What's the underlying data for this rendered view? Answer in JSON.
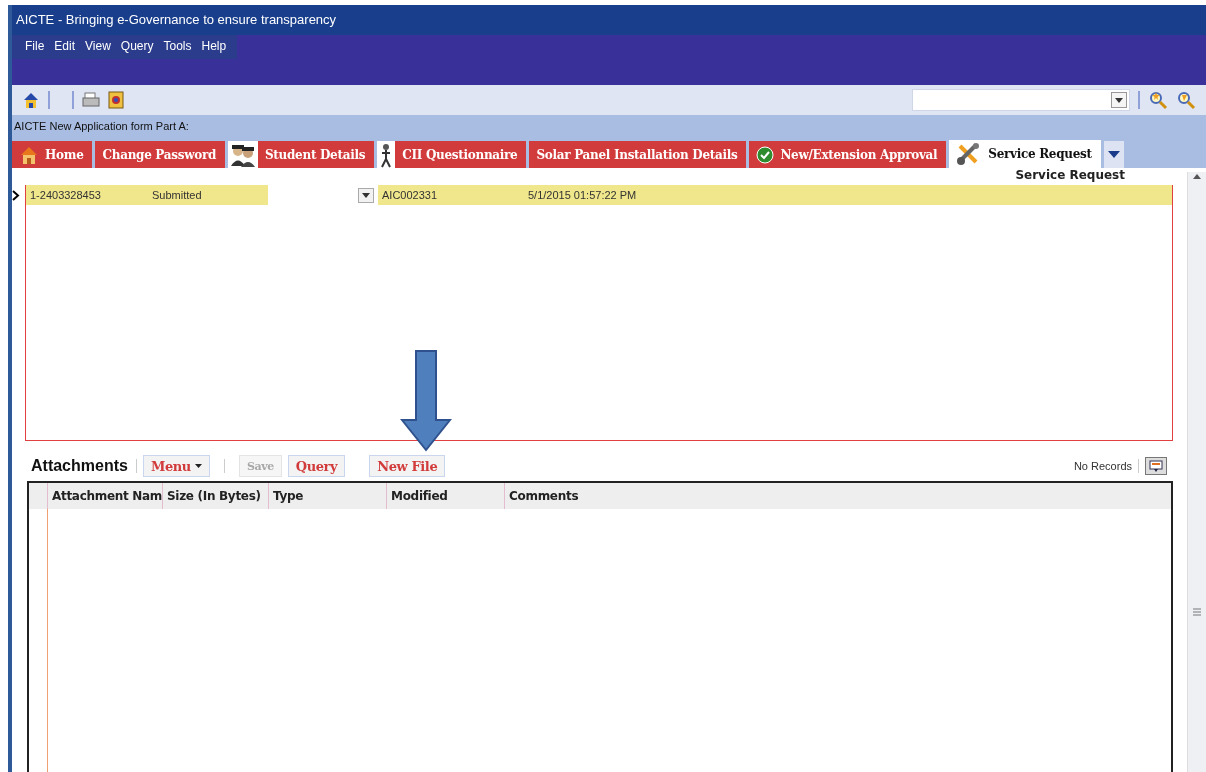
{
  "window": {
    "title": "AICTE - Bringing e-Governance to ensure transparency"
  },
  "menu": [
    "File",
    "Edit",
    "View",
    "Query",
    "Tools",
    "Help"
  ],
  "breadcrumb": "AICTE New Application form Part A:",
  "tabs": [
    {
      "label": "Home",
      "kind": "home",
      "selected": false
    },
    {
      "label": "Change Password",
      "kind": "plain",
      "selected": false
    },
    {
      "label": "Student Details",
      "kind": "people",
      "selected": false
    },
    {
      "label": "CII Questionnaire",
      "kind": "figure",
      "selected": false
    },
    {
      "label": "Solar Panel Installation Details",
      "kind": "plain",
      "selected": false
    },
    {
      "label": "New/Extension Approval",
      "kind": "check",
      "selected": false
    },
    {
      "label": "Service Request",
      "kind": "tools",
      "selected": true
    }
  ],
  "view_title": "Service Request",
  "records": [
    {
      "cells": [
        "1-2403328453",
        "Submitted",
        "AIC002331",
        "5/1/2015 01:57:22 PM"
      ],
      "selected": true
    }
  ],
  "attachments": {
    "title": "Attachments",
    "buttons": [
      {
        "label": "Menu",
        "kind": "menu",
        "disabled": false
      },
      {
        "label": "Save",
        "kind": "plain",
        "disabled": true
      },
      {
        "label": "Query",
        "kind": "plain",
        "disabled": false
      },
      {
        "label": "New File",
        "kind": "plain",
        "disabled": false
      }
    ],
    "record_count": "No Records",
    "columns": [
      "Attachment Nam",
      "Size (In Bytes)",
      "Type",
      "Modified",
      "Comments"
    ]
  }
}
